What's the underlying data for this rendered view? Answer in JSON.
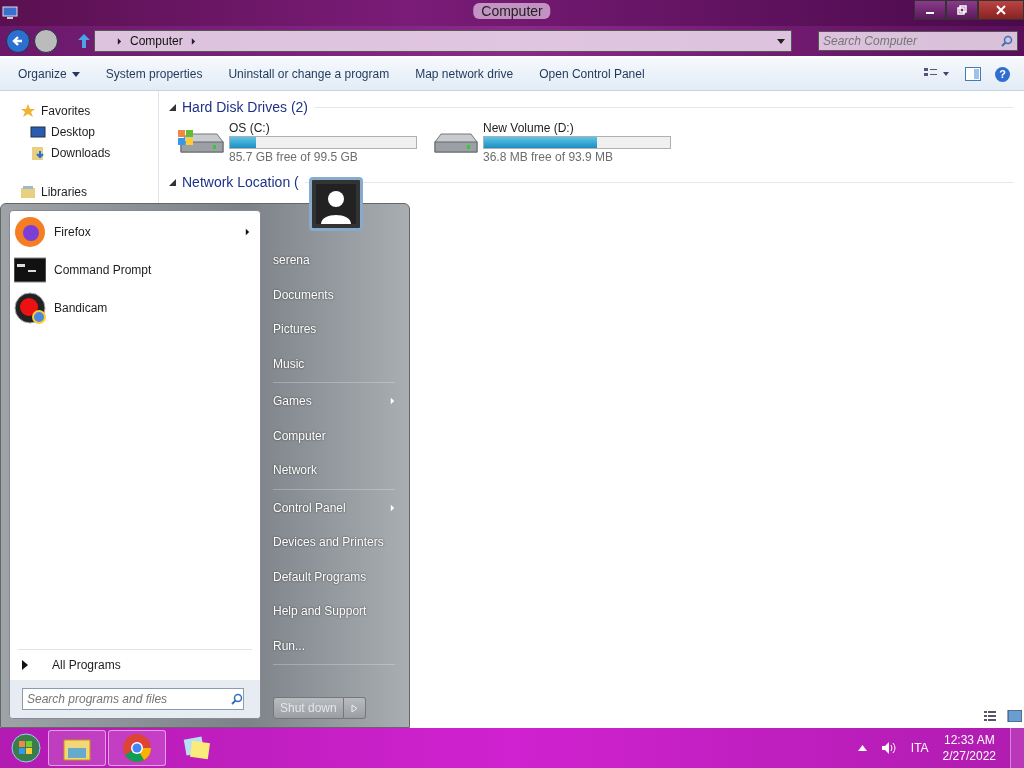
{
  "window": {
    "title": "Computer",
    "address": [
      "Computer"
    ],
    "search_placeholder": "Search Computer"
  },
  "toolbar": [
    {
      "label": "Organize",
      "dropdown": true
    },
    {
      "label": "System properties",
      "dropdown": false
    },
    {
      "label": "Uninstall or change a program",
      "dropdown": false
    },
    {
      "label": "Map network drive",
      "dropdown": false
    },
    {
      "label": "Open Control Panel",
      "dropdown": false
    }
  ],
  "help_icon": "?",
  "nav": [
    {
      "label": "Favorites",
      "kind": "star",
      "children": [
        {
          "label": "Desktop",
          "kind": "desktop"
        },
        {
          "label": "Downloads",
          "kind": "download"
        }
      ]
    },
    {
      "label": "Libraries",
      "kind": "library"
    }
  ],
  "sections": [
    {
      "title": "Hard Disk Drives (2)",
      "drives": [
        {
          "name": "OS (C:)",
          "kind": "system",
          "level": 0.14,
          "free": "85.7 GB free of 99.5 GB"
        },
        {
          "name": "New Volume (D:)",
          "kind": "plain",
          "level": 0.61,
          "free": "36.8 MB free of 93.9 MB"
        }
      ]
    },
    {
      "title": "Network Location ("
    }
  ],
  "start_menu": {
    "programs": [
      {
        "label": "Firefox",
        "kind": "firefox",
        "submenu": true
      },
      {
        "label": "Command Prompt",
        "kind": "cmd",
        "submenu": false
      },
      {
        "label": "Bandicam",
        "kind": "bandicam",
        "submenu": false
      }
    ],
    "all_programs": "All Programs",
    "search_placeholder": "Search programs and files",
    "places": [
      [
        {
          "label": "serena",
          "submenu": false
        },
        {
          "label": "Documents",
          "submenu": false
        },
        {
          "label": "Pictures",
          "submenu": false
        },
        {
          "label": "Music",
          "submenu": false
        }
      ],
      [
        {
          "label": "Games",
          "submenu": true
        },
        {
          "label": "Computer",
          "submenu": false
        },
        {
          "label": "Network",
          "submenu": false
        }
      ],
      [
        {
          "label": "Control Panel",
          "submenu": true
        },
        {
          "label": "Devices and Printers",
          "submenu": false
        },
        {
          "label": "Default Programs",
          "submenu": false
        },
        {
          "label": "Help and Support",
          "submenu": false
        },
        {
          "label": "Run...",
          "submenu": false
        }
      ]
    ],
    "shutdown": {
      "label": "Shut down",
      "disabled": true
    }
  },
  "taskbar": {
    "apps": [
      {
        "kind": "explorer",
        "selected": true
      },
      {
        "kind": "chrome",
        "selected": true
      },
      {
        "kind": "notes",
        "selected": false
      }
    ],
    "language": "ITA",
    "time": "12:33 AM",
    "date": "2/27/2022"
  }
}
